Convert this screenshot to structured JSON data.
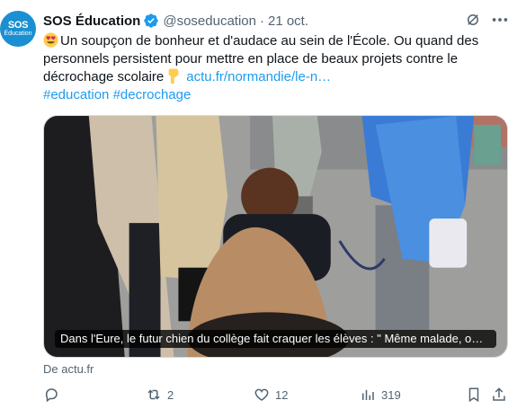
{
  "avatar": {
    "line1": "SOS",
    "line2": "Éducation"
  },
  "author": {
    "name": "SOS Éducation",
    "handle": "@soseducation",
    "separator": "·",
    "date": "21 oct."
  },
  "tweet": {
    "text_part1": "Un soupçon de bonheur et d'audace au sein de l'École. Ou quand des personnels persistent pour mettre en place de beaux projets contre le décrochage scolaire",
    "link": "actu.fr/normandie/le-n…",
    "hashtag1": "#education",
    "hashtag2": "#decrochage"
  },
  "media": {
    "caption": "Dans l'Eure, le futur chien du collège fait craquer les élèves : \" Même malade, o…"
  },
  "source": "De actu.fr",
  "actions": {
    "reply_count": "",
    "retweet_count": "2",
    "like_count": "12",
    "views_count": "319"
  },
  "icons": [
    "verified-badge-icon",
    "grok-icon",
    "more-icon",
    "smiling-heart-eyes-emoji",
    "pointing-down-emoji",
    "reply-icon",
    "retweet-icon",
    "like-icon",
    "views-icon",
    "bookmark-icon",
    "share-icon"
  ],
  "colors": {
    "accent": "#1d9bf0",
    "muted": "#536471",
    "text": "#0f1419"
  }
}
